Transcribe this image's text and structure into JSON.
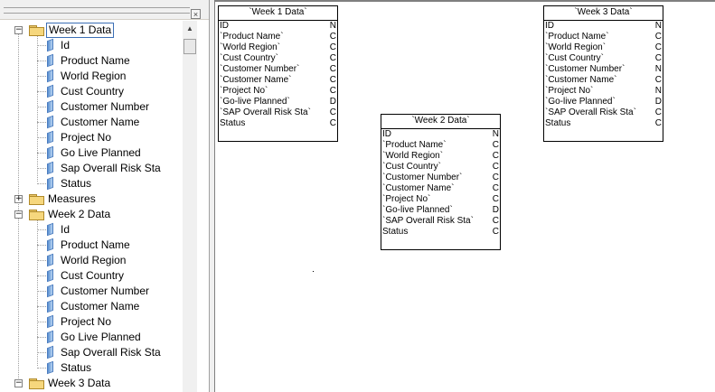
{
  "tree": {
    "groups": [
      {
        "label": "Week 1 Data",
        "expander": "−",
        "selected": true,
        "fields": [
          "Id",
          "Product Name",
          "World Region",
          "Cust Country",
          "Customer Number",
          "Customer Name",
          "Project No",
          "Go Live Planned",
          "Sap Overall Risk Sta",
          "Status"
        ]
      },
      {
        "label": "Measures",
        "expander": "+",
        "selected": false,
        "fields": []
      },
      {
        "label": "Week 2 Data",
        "expander": "−",
        "selected": false,
        "fields": [
          "Id",
          "Product Name",
          "World Region",
          "Cust Country",
          "Customer Number",
          "Customer Name",
          "Project No",
          "Go Live Planned",
          "Sap Overall Risk Sta",
          "Status"
        ]
      },
      {
        "label": "Week 3 Data",
        "expander": "−",
        "selected": false,
        "fields": []
      }
    ],
    "close_glyph": "×"
  },
  "scrollbar": {
    "up_glyph": "▲"
  },
  "tables": [
    {
      "title": "`Week 1 Data`",
      "fields": [
        {
          "name": "ID",
          "type": "N"
        },
        {
          "name": "`Product Name`",
          "type": "C"
        },
        {
          "name": "`World Region`",
          "type": "C"
        },
        {
          "name": "`Cust Country`",
          "type": "C"
        },
        {
          "name": "`Customer Number`",
          "type": "C"
        },
        {
          "name": "`Customer Name`",
          "type": "C"
        },
        {
          "name": "`Project No`",
          "type": "C"
        },
        {
          "name": "`Go-live Planned`",
          "type": "D"
        },
        {
          "name": "`SAP Overall Risk Sta`",
          "type": "C"
        },
        {
          "name": "Status",
          "type": "C"
        }
      ]
    },
    {
      "title": "`Week 2 Data`",
      "fields": [
        {
          "name": "ID",
          "type": "N"
        },
        {
          "name": "`Product Name`",
          "type": "C"
        },
        {
          "name": "`World Region`",
          "type": "C"
        },
        {
          "name": "`Cust Country`",
          "type": "C"
        },
        {
          "name": "`Customer Number`",
          "type": "C"
        },
        {
          "name": "`Customer Name`",
          "type": "C"
        },
        {
          "name": "`Project No`",
          "type": "C"
        },
        {
          "name": "`Go-live Planned`",
          "type": "D"
        },
        {
          "name": "`SAP Overall Risk Sta`",
          "type": "C"
        },
        {
          "name": "Status",
          "type": "C"
        }
      ]
    },
    {
      "title": "`Week 3 Data`",
      "fields": [
        {
          "name": "ID",
          "type": "N"
        },
        {
          "name": "`Product Name`",
          "type": "C"
        },
        {
          "name": "`World Region`",
          "type": "C"
        },
        {
          "name": "`Cust Country`",
          "type": "C"
        },
        {
          "name": "`Customer Number`",
          "type": "N"
        },
        {
          "name": "`Customer Name`",
          "type": "C"
        },
        {
          "name": "`Project No`",
          "type": "N"
        },
        {
          "name": "`Go-live Planned`",
          "type": "D"
        },
        {
          "name": "`SAP Overall Risk Sta`",
          "type": "C"
        },
        {
          "name": "Status",
          "type": "C"
        }
      ]
    }
  ]
}
